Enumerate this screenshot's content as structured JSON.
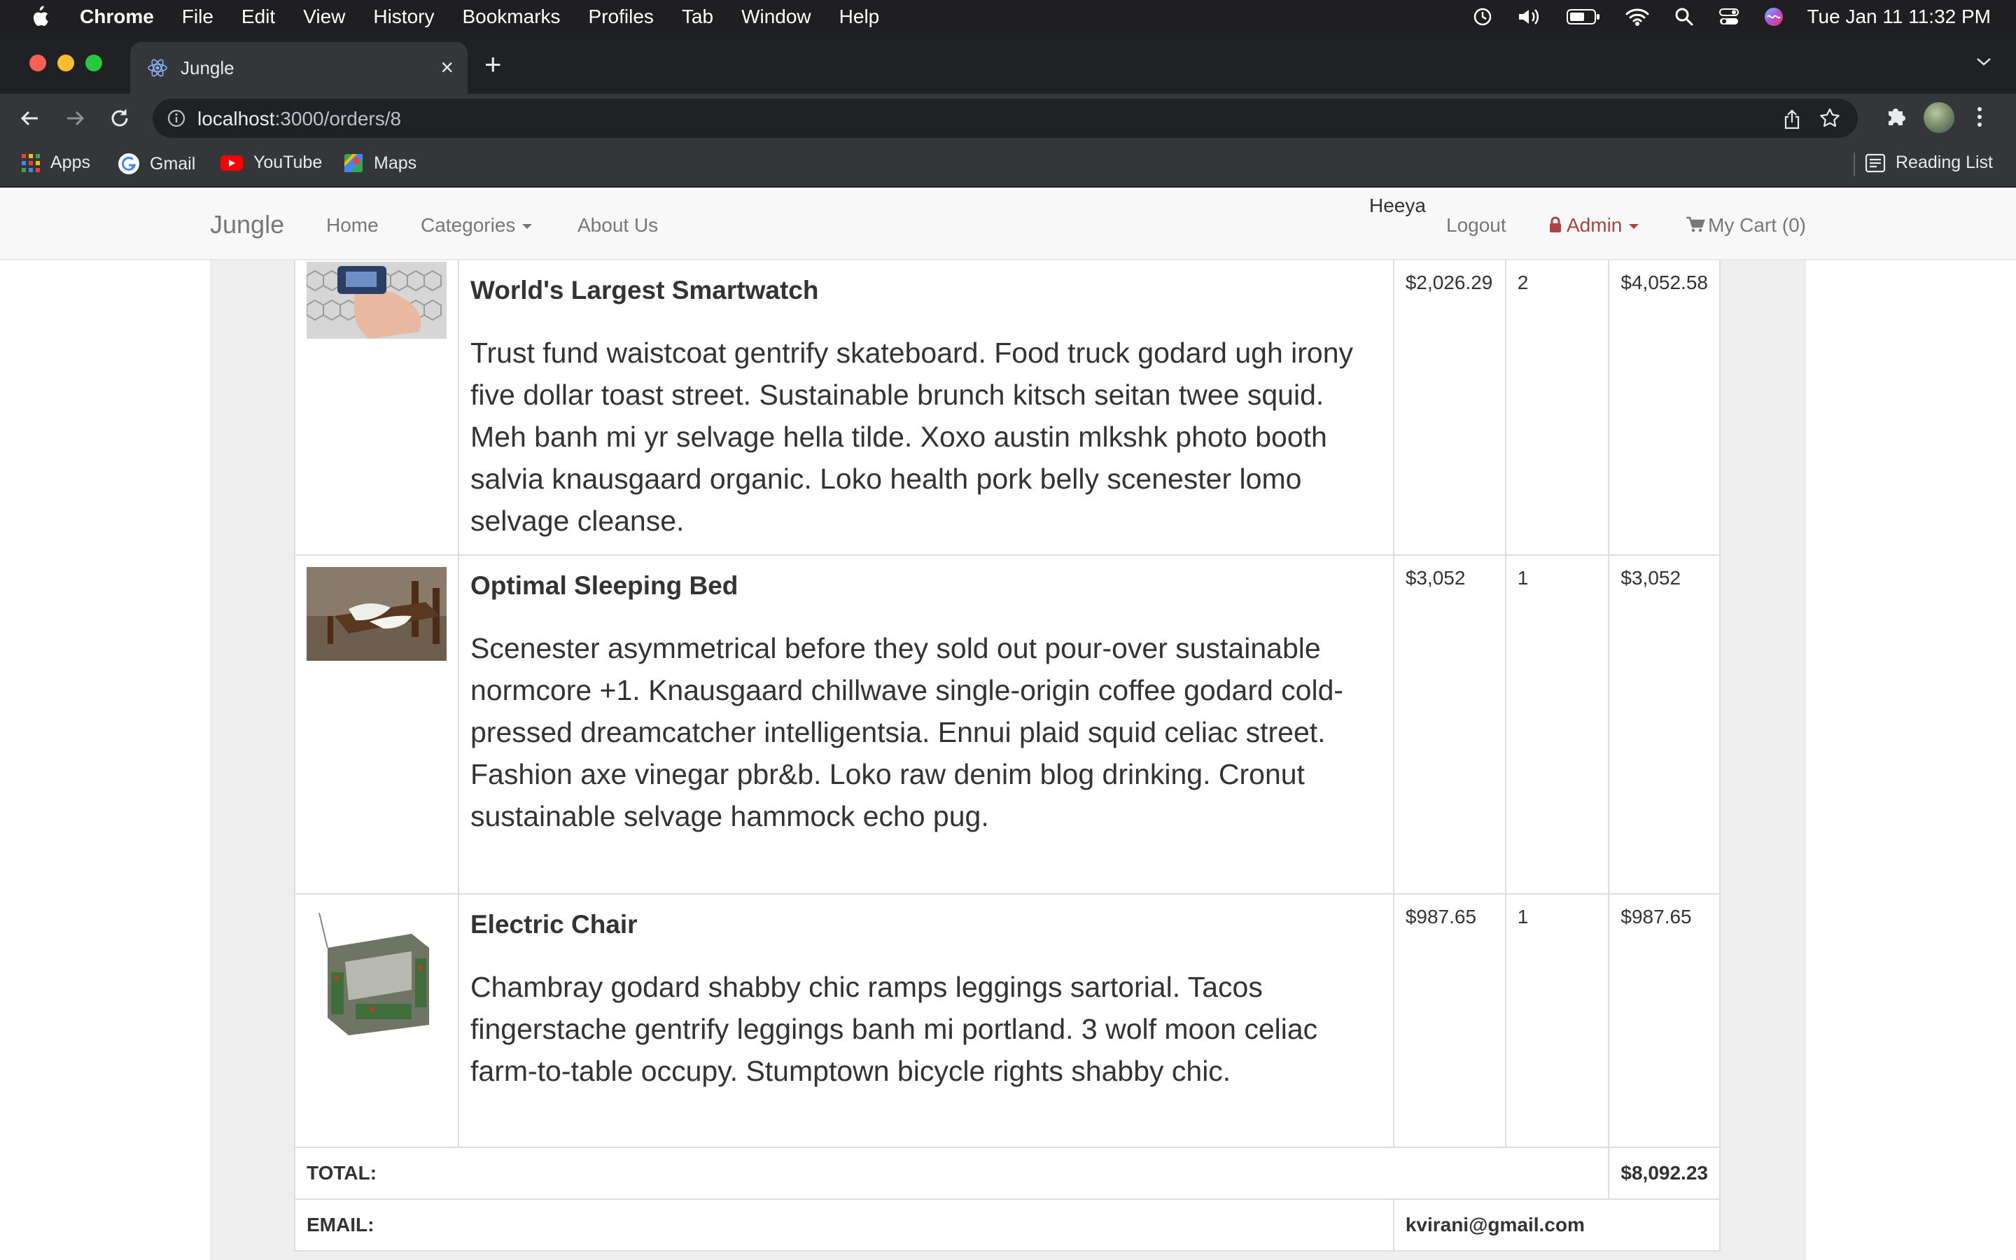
{
  "menubar": {
    "app": "Chrome",
    "items": [
      "File",
      "Edit",
      "View",
      "History",
      "Bookmarks",
      "Profiles",
      "Tab",
      "Window",
      "Help"
    ],
    "clock": "Tue Jan 11  11:32 PM"
  },
  "tab": {
    "title": "Jungle"
  },
  "address": {
    "host": "localhost",
    "path": ":3000/orders/8"
  },
  "bookmarks": {
    "items": [
      "Apps",
      "Gmail",
      "YouTube",
      "Maps"
    ],
    "reading_list": "Reading List"
  },
  "navbar": {
    "brand": "Jungle",
    "home": "Home",
    "categories": "Categories",
    "about": "About Us",
    "user": "Heeya",
    "logout": "Logout",
    "admin": "Admin",
    "cart": "My Cart (0)"
  },
  "order": {
    "items": [
      {
        "name": "World's Largest Smartwatch",
        "description": "Trust fund waistcoat gentrify skateboard. Food truck godard ugh irony five dollar toast street. Sustainable brunch kitsch seitan twee squid. Meh banh mi yr selvage hella tilde. Xoxo austin mlkshk photo booth salvia knausgaard organic. Loko health pork belly scenester lomo selvage cleanse.",
        "price": "$2,026.29",
        "quantity": "2",
        "total": "$4,052.58"
      },
      {
        "name": "Optimal Sleeping Bed",
        "description": "Scenester asymmetrical before they sold out pour-over sustainable normcore +1. Knausgaard chillwave single-origin coffee godard cold-pressed dreamcatcher intelligentsia. Ennui plaid squid celiac street. Fashion axe vinegar pbr&b. Loko raw denim blog drinking. Cronut sustainable selvage hammock echo pug.",
        "price": "$3,052",
        "quantity": "1",
        "total": "$3,052"
      },
      {
        "name": "Electric Chair",
        "description": "Chambray godard shabby chic ramps leggings sartorial. Tacos fingerstache gentrify leggings banh mi portland. 3 wolf moon celiac farm-to-table occupy. Stumptown bicycle rights shabby chic.",
        "price": "$987.65",
        "quantity": "1",
        "total": "$987.65"
      }
    ],
    "total_label": "TOTAL:",
    "total_value": "$8,092.23",
    "email_label": "EMAIL:",
    "email_value": "kvirani@gmail.com"
  }
}
